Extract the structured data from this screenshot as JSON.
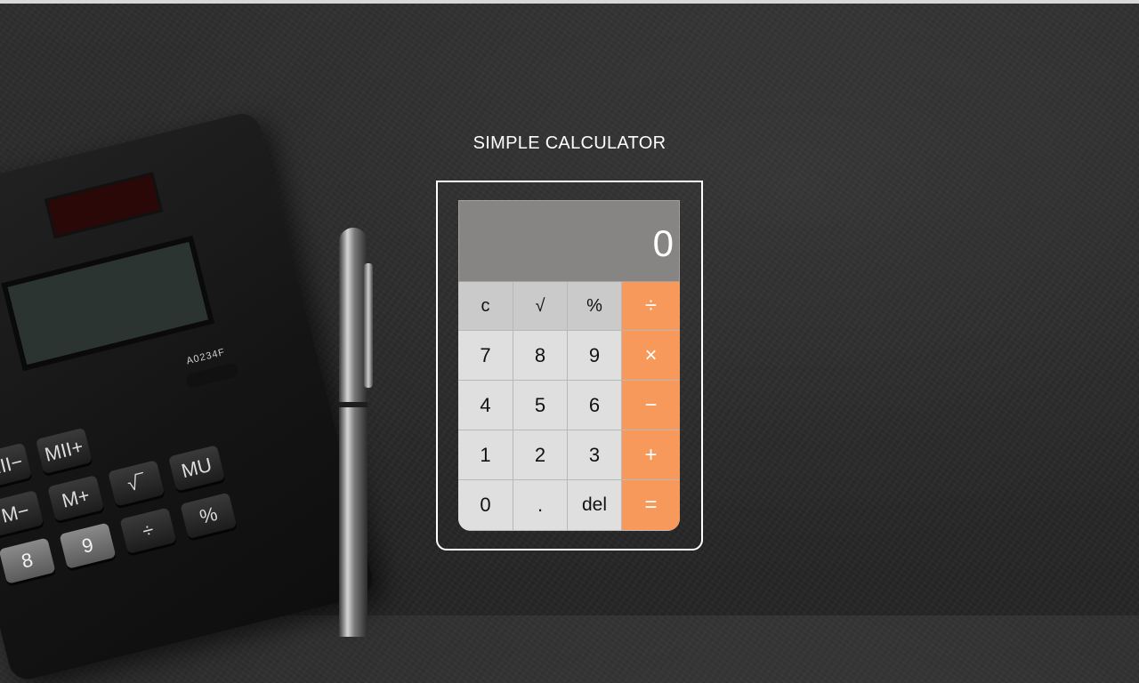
{
  "app": {
    "title": "SIMPLE CALCULATOR"
  },
  "display": {
    "value": "0"
  },
  "keys": {
    "row1": [
      "c",
      "√",
      "%",
      "÷"
    ],
    "row2": [
      "7",
      "8",
      "9",
      "×"
    ],
    "row3": [
      "4",
      "5",
      "6",
      "−"
    ],
    "row4": [
      "1",
      "2",
      "3",
      "+"
    ],
    "row5": [
      "0",
      ".",
      "del",
      "="
    ]
  },
  "background_calculator": {
    "switch_label": "A0234F",
    "keys": [
      "MII−",
      "MII+",
      "M−",
      "M+",
      "√‾",
      "MU",
      "8",
      "9",
      "÷",
      "%"
    ]
  },
  "colors": {
    "operator": "#f7995a",
    "display": "#878583",
    "function_key": "#cbcaca",
    "digit_key": "#e0dfdf",
    "title": "#ffffff"
  }
}
